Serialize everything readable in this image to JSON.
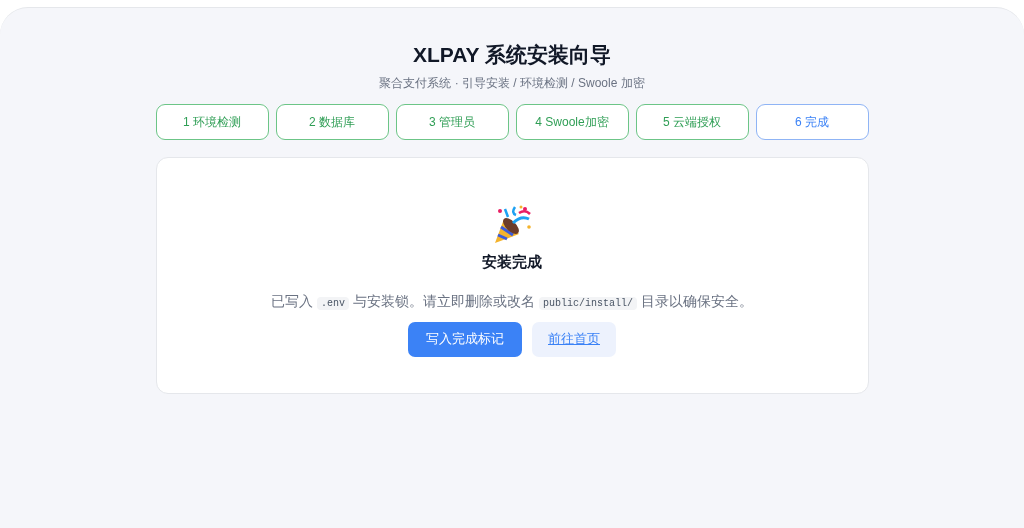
{
  "title": "XLPAY 系统安装向导",
  "subtitle": "聚合支付系统 · 引导安装 / 环境检测 / Swoole 加密",
  "steps": [
    {
      "label": "1 环境检测",
      "selected": false
    },
    {
      "label": "2 数据库",
      "selected": false
    },
    {
      "label": "3 管理员",
      "selected": false
    },
    {
      "label": "4 Swoole加密",
      "selected": false
    },
    {
      "label": "5 云端授权",
      "selected": false
    },
    {
      "label": "6 完成",
      "selected": true
    }
  ],
  "card": {
    "heading": "安装完成",
    "message": [
      {
        "kind": "text",
        "text": "已写入 "
      },
      {
        "kind": "code",
        "text": ".env"
      },
      {
        "kind": "text",
        "text": " 与安装锁。请立即删除或改名 "
      },
      {
        "kind": "code",
        "text": "public/install/"
      },
      {
        "kind": "text",
        "text": " 目录以确保安全。"
      }
    ],
    "buttons": [
      {
        "kind": "primary",
        "label": "写入完成标记"
      },
      {
        "kind": "link",
        "label": "前往首页"
      }
    ]
  }
}
